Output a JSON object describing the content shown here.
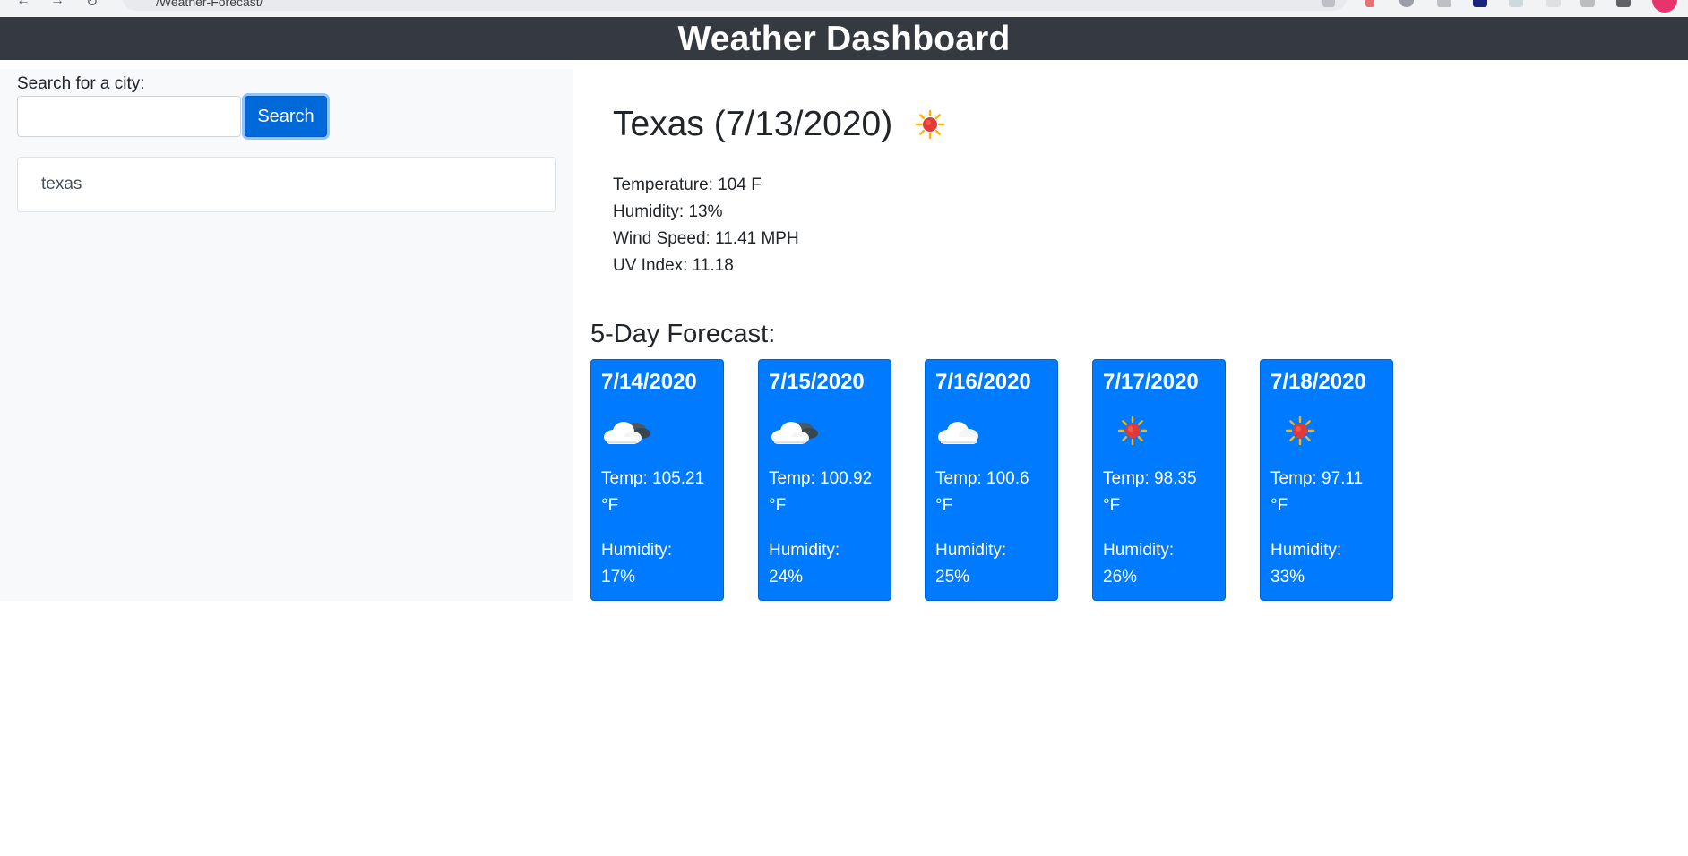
{
  "browser": {
    "url_fragment": "/Weather-Forecast/"
  },
  "header": {
    "title": "Weather Dashboard"
  },
  "sidebar": {
    "search_label": "Search for a city:",
    "search_value": "",
    "search_placeholder": "",
    "search_button_label": "Search",
    "history": [
      "texas"
    ]
  },
  "current": {
    "title": "Texas (7/13/2020)",
    "icon": "sun-icon",
    "temperature": "Temperature: 104 F",
    "humidity": "Humidity: 13%",
    "wind_speed": "Wind Speed: 11.41 MPH",
    "uv_index": "UV Index: 11.18"
  },
  "forecast": {
    "heading": "5-Day Forecast:",
    "days": [
      {
        "date": "7/14/2020",
        "icon": "cloud-dark-icon",
        "temp_line1": "Temp: 105.21",
        "temp_line2": "°F",
        "hum_line1": "Humidity:",
        "hum_line2": "17%"
      },
      {
        "date": "7/15/2020",
        "icon": "cloud-dark-icon",
        "temp_line1": "Temp: 100.92",
        "temp_line2": "°F",
        "hum_line1": "Humidity:",
        "hum_line2": "24%"
      },
      {
        "date": "7/16/2020",
        "icon": "cloud-icon",
        "temp_line1": "Temp: 100.6",
        "temp_line2": "°F",
        "hum_line1": "Humidity:",
        "hum_line2": "25%"
      },
      {
        "date": "7/17/2020",
        "icon": "sun-icon",
        "temp_line1": "Temp: 98.35",
        "temp_line2": "°F",
        "hum_line1": "Humidity:",
        "hum_line2": "26%"
      },
      {
        "date": "7/18/2020",
        "icon": "sun-icon",
        "temp_line1": "Temp: 97.11",
        "temp_line2": "°F",
        "hum_line1": "Humidity:",
        "hum_line2": "33%"
      }
    ]
  },
  "colors": {
    "header_bg": "#343a40",
    "sidebar_bg": "#f8f9fa",
    "card_bg": "#007bff",
    "button_bg": "#0069d9",
    "sun_core": "#e53935",
    "sun_ray": "#ffb300"
  }
}
